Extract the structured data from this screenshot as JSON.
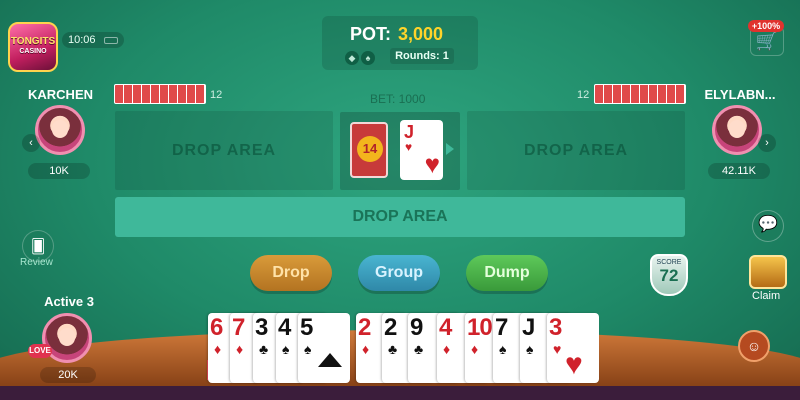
{
  "app": {
    "logo_text": "TONGITS",
    "logo_sub": "CASINO"
  },
  "status": {
    "time": "10:06"
  },
  "pot": {
    "label": "POT:",
    "value": "3,000",
    "rounds_label": "Rounds: 1"
  },
  "shop": {
    "promo": "+100%"
  },
  "players": {
    "left": {
      "name": "KARCHEN",
      "chips": "10K",
      "deck_count": "12"
    },
    "right": {
      "name": "ELYLABN...",
      "chips": "42.11K",
      "deck_count": "12"
    },
    "self": {
      "name": "Active 3",
      "chips": "20K",
      "badge": "LOVE"
    }
  },
  "table": {
    "bet": "BET: 1000",
    "drop_left": "DROP AREA",
    "drop_right": "DROP AREA",
    "drop_center": "DROP AREA",
    "deck_remaining": "14",
    "discard_rank": "J",
    "discard_suit": "♥"
  },
  "actions": {
    "drop": "Drop",
    "group": "Group",
    "dump": "Dump"
  },
  "side": {
    "review": "Review",
    "claim": "Claim",
    "score_label": "SCORE",
    "score": "72"
  },
  "hand": [
    {
      "rank": "6",
      "suit": "♦",
      "color": "#d0222b"
    },
    {
      "rank": "7",
      "suit": "♦",
      "color": "#d0222b"
    },
    {
      "rank": "3",
      "suit": "♣",
      "color": "#111111"
    },
    {
      "rank": "4",
      "suit": "♠",
      "color": "#111111"
    },
    {
      "rank": "5",
      "suit": "♠",
      "color": "#111111"
    },
    {
      "rank": "2",
      "suit": "♦",
      "color": "#d0222b"
    },
    {
      "rank": "2",
      "suit": "♣",
      "color": "#111111"
    },
    {
      "rank": "9",
      "suit": "♣",
      "color": "#111111"
    },
    {
      "rank": "4",
      "suit": "♦",
      "color": "#d0222b"
    },
    {
      "rank": "10",
      "suit": "♦",
      "color": "#d0222b"
    },
    {
      "rank": "7",
      "suit": "♠",
      "color": "#111111"
    },
    {
      "rank": "J",
      "suit": "♠",
      "color": "#111111"
    },
    {
      "rank": "3",
      "suit": "♥",
      "color": "#d0222b"
    }
  ]
}
